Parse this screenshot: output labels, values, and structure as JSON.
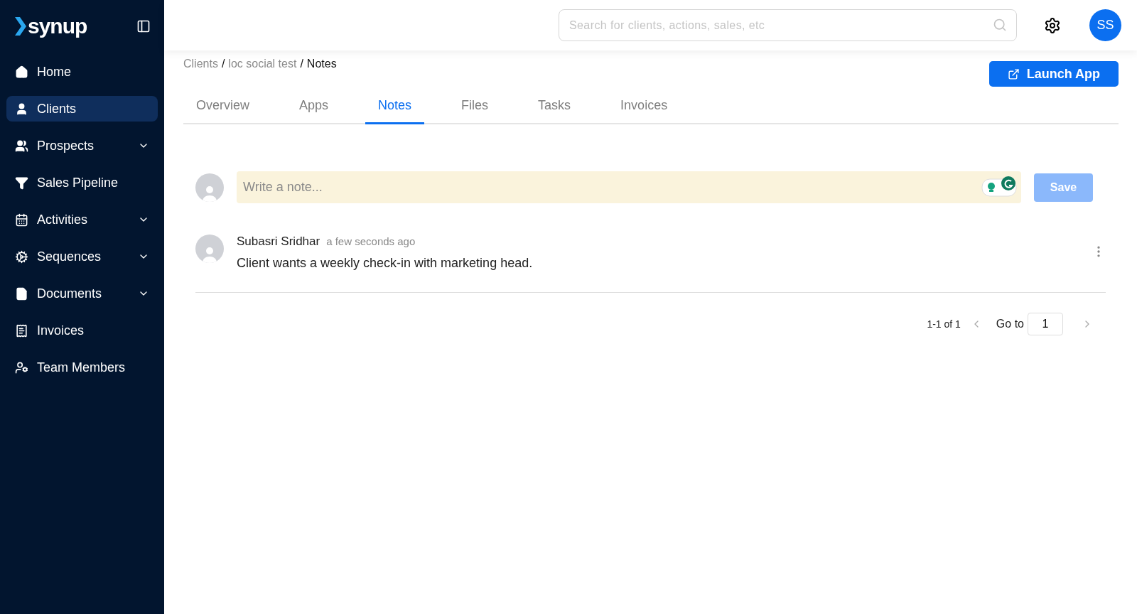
{
  "sidebar": {
    "logo": "synup",
    "items": [
      {
        "label": "Home",
        "selected": false,
        "kind": "link"
      },
      {
        "label": "Clients",
        "selected": true,
        "kind": "link"
      },
      {
        "label": "Prospects",
        "selected": false,
        "kind": "group"
      },
      {
        "label": "Sales Pipeline",
        "selected": false,
        "kind": "link"
      },
      {
        "label": "Activities",
        "selected": false,
        "kind": "group"
      },
      {
        "label": "Sequences",
        "selected": false,
        "kind": "group"
      },
      {
        "label": "Documents",
        "selected": false,
        "kind": "group"
      },
      {
        "label": "Invoices",
        "selected": false,
        "kind": "link"
      },
      {
        "label": "Team Members",
        "selected": false,
        "kind": "link"
      }
    ]
  },
  "header": {
    "search": {
      "placeholder": "Search for clients, actions, sales, etc"
    },
    "avatar": "SS"
  },
  "breadcrumb": {
    "separator": "/",
    "items": [
      "Clients",
      "loc social test",
      "Notes"
    ]
  },
  "launch_button": "Launch App",
  "tabs": [
    {
      "label": "Overview",
      "selected": false
    },
    {
      "label": "Apps",
      "selected": false
    },
    {
      "label": "Notes",
      "selected": true
    },
    {
      "label": "Files",
      "selected": false
    },
    {
      "label": "Tasks",
      "selected": false
    },
    {
      "label": "Invoices",
      "selected": false
    }
  ],
  "note_input": {
    "placeholder": "Write a note...",
    "save": "Save",
    "disabled": true
  },
  "notes": [
    {
      "author": "Subasri Sridhar",
      "time": "a few seconds ago",
      "text": "Client wants a weekly check-in with marketing head."
    }
  ],
  "pagination": {
    "range": "1-1 of 1",
    "goto_label": "Go to",
    "page": "1"
  }
}
